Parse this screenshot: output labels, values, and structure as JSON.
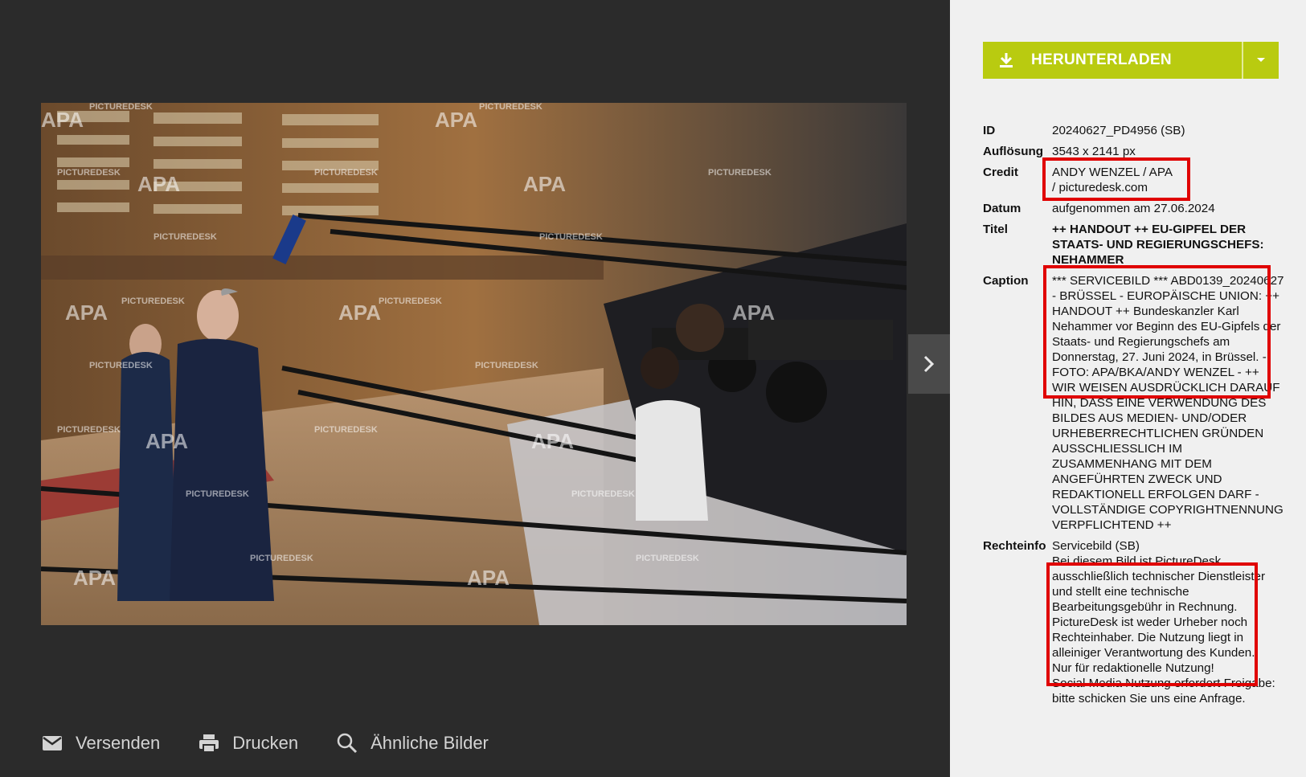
{
  "download": {
    "label": "HERUNTERLADEN",
    "icon": "download-icon",
    "dropdown_icon": "caret-down-icon",
    "color": "#b9cb10"
  },
  "next_icon": "chevron-right-icon",
  "watermarks": {
    "picturedesk": "PICTUREDESK",
    "apa": "APA"
  },
  "actions": [
    {
      "label": "Versenden",
      "icon": "mail-icon"
    },
    {
      "label": "Drucken",
      "icon": "print-icon"
    },
    {
      "label": "Ähnliche Bilder",
      "icon": "search-icon"
    }
  ],
  "meta": {
    "id_key": "ID",
    "id_val": "20240627_PD4956 (SB)",
    "res_key": "Auflösung",
    "res_val": "3543 x 2141 px",
    "credit_key": "Credit",
    "credit_val": "ANDY WENZEL / APA / picturedesk.com",
    "date_key": "Datum",
    "date_val": "aufgenommen am 27.06.2024",
    "title_key": "Titel",
    "title_val": "++ HANDOUT ++ EU-GIPFEL DER STAATS- UND REGIERUNGSCHEFS: NEHAMMER",
    "caption_key": "Caption",
    "caption_val": "*** SERVICEBILD *** ABD0139_20240627 - BRÜSSEL - EUROPÄISCHE UNION: ++ HANDOUT ++ Bundeskanzler Karl Nehammer vor Beginn des EU-Gipfels der Staats- und Regierungschefs am Donnerstag, 27. Juni 2024, in Brüssel. - FOTO: APA/BKA/ANDY WENZEL - ++ WIR WEISEN AUSDRÜCKLICH DARAUF HIN, DASS EINE VERWENDUNG DES BILDES AUS MEDIEN- UND/ODER URHEBERRECHTLICHEN GRÜNDEN AUSSCHLIESSLICH IM ZUSAMMENHANG MIT DEM ANGEFÜHRTEN ZWECK UND REDAKTIONELL ERFOLGEN DARF - VOLLSTÄNDIGE COPYRIGHTNENNUNG VERPFLICHTEND ++",
    "rights_key": "Rechteinfo",
    "rights_val_1": "Servicebild (SB)",
    "rights_val_2": "Bei diesem Bild ist PictureDesk ausschließlich technischer Dienstleister und stellt eine technische Bearbeitungsgebühr in Rechnung. PictureDesk ist weder Urheber noch Rechteinhaber. Die Nutzung liegt in alleiniger Verantwortung des Kunden.",
    "rights_val_3": "Nur für redaktionelle Nutzung!",
    "rights_val_4": "Social Media Nutzung erfordert Freigabe: bitte schicken Sie uns eine Anfrage."
  }
}
